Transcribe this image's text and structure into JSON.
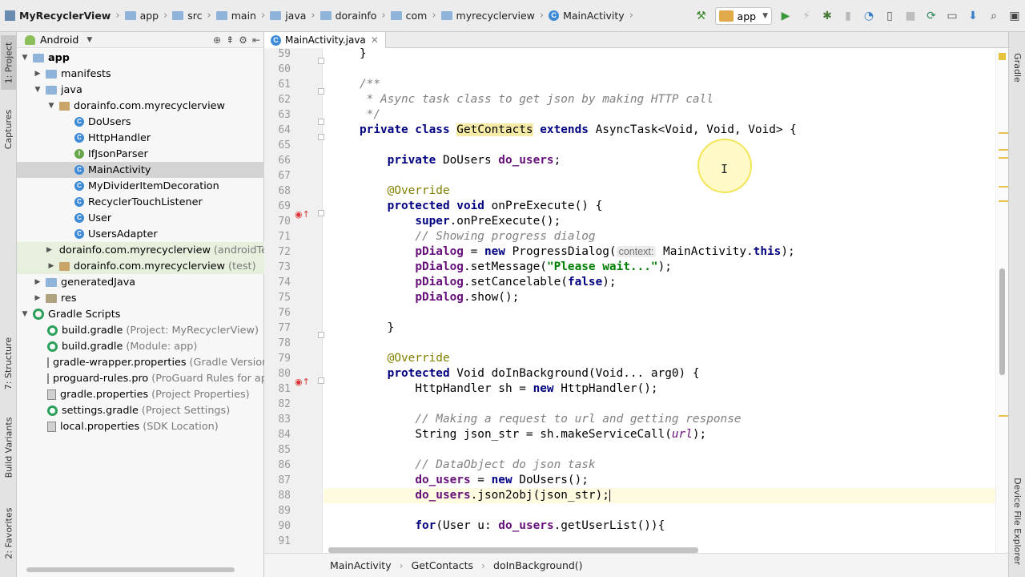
{
  "navbar": {
    "crumbs": [
      "MyRecyclerView",
      "app",
      "src",
      "main",
      "java",
      "dorainfo",
      "com",
      "myrecyclerview",
      "MainActivity"
    ],
    "run_config": "app"
  },
  "left_strip": {
    "tabs": [
      "1: Project",
      "Captures",
      "7: Structure",
      "Build Variants",
      "2: Favorites"
    ]
  },
  "right_strip": {
    "tabs": [
      "Gradle",
      "Device File Explorer"
    ]
  },
  "panel": {
    "view_mode": "Android"
  },
  "tree": [
    {
      "label": "app",
      "extra": ""
    },
    {
      "label": "manifests",
      "extra": ""
    },
    {
      "label": "java",
      "extra": ""
    },
    {
      "label": "dorainfo.com.myrecyclerview",
      "extra": ""
    },
    {
      "label": "DoUsers",
      "extra": ""
    },
    {
      "label": "HttpHandler",
      "extra": ""
    },
    {
      "label": "IfJsonParser",
      "extra": ""
    },
    {
      "label": "MainActivity",
      "extra": ""
    },
    {
      "label": "MyDividerItemDecoration",
      "extra": ""
    },
    {
      "label": "RecyclerTouchListener",
      "extra": ""
    },
    {
      "label": "User",
      "extra": ""
    },
    {
      "label": "UsersAdapter",
      "extra": ""
    },
    {
      "label": "dorainfo.com.myrecyclerview",
      "extra": "(androidTest)"
    },
    {
      "label": "dorainfo.com.myrecyclerview",
      "extra": "(test)"
    },
    {
      "label": "generatedJava",
      "extra": ""
    },
    {
      "label": "res",
      "extra": ""
    },
    {
      "label": "Gradle Scripts",
      "extra": ""
    },
    {
      "label": "build.gradle",
      "extra": "(Project: MyRecyclerView)"
    },
    {
      "label": "build.gradle",
      "extra": "(Module: app)"
    },
    {
      "label": "gradle-wrapper.properties",
      "extra": "(Gradle Version)"
    },
    {
      "label": "proguard-rules.pro",
      "extra": "(ProGuard Rules for app)"
    },
    {
      "label": "gradle.properties",
      "extra": "(Project Properties)"
    },
    {
      "label": "settings.gradle",
      "extra": "(Project Settings)"
    },
    {
      "label": "local.properties",
      "extra": "(SDK Location)"
    }
  ],
  "editor": {
    "tab_label": "MainActivity.java",
    "line_numbers": [
      "59",
      "60",
      "61",
      "62",
      "63",
      "64",
      "65",
      "66",
      "67",
      "68",
      "69",
      "70",
      "71",
      "72",
      "73",
      "74",
      "75",
      "76",
      "77",
      "78",
      "79",
      "80",
      "81",
      "82",
      "83",
      "84",
      "85",
      "86",
      "87",
      "88",
      "89",
      "90",
      "91"
    ],
    "code": {
      "l59": "}",
      "l61": "/**",
      "l62": " * Async task class to get json by making HTTP call",
      "l63": " */",
      "l64_kw1": "private class ",
      "l64_cls": "GetContacts",
      "l64_kw2": " extends ",
      "l64_rest": "AsyncTask<Void, Void, Void> {",
      "l66_kw": "private ",
      "l66_type": "DoUsers ",
      "l66_fld": "do_users",
      "l66_end": ";",
      "l68": "@Override",
      "l69_kw": "protected void ",
      "l69_rest": "onPreExecute() {",
      "l70_kw": "super",
      "l70_rest": ".onPreExecute();",
      "l71": "// Showing progress dialog",
      "l72_fld": "pDialog",
      "l72_mid": " = ",
      "l72_kw": "new ",
      "l72_call": "ProgressDialog(",
      "l72_hint": "context:",
      "l72_arg": " MainActivity.",
      "l72_this": "this",
      "l72_end": ");",
      "l73_fld": "pDialog",
      "l73_call": ".setMessage(",
      "l73_str": "\"Please wait...\"",
      "l73_end": ");",
      "l74_fld": "pDialog",
      "l74_call": ".setCancelable(",
      "l74_kw": "false",
      "l74_end": ");",
      "l75_fld": "pDialog",
      "l75_end": ".show();",
      "l77": "}",
      "l79": "@Override",
      "l80_kw": "protected ",
      "l80_rest": "Void doInBackground(Void... arg0) {",
      "l81_a": "HttpHandler sh = ",
      "l81_kw": "new ",
      "l81_b": "HttpHandler();",
      "l83": "// Making a request to url and getting response",
      "l84_a": "String json_str = sh.makeServiceCall(",
      "l84_it": "url",
      "l84_b": ");",
      "l86": "// DataObject do json task",
      "l87_fld": "do_users",
      "l87_mid": " = ",
      "l87_kw": "new ",
      "l87_end": "DoUsers();",
      "l88_fld": "do_users",
      "l88_end": ".json2obj(json_str);",
      "l90_kw": "for",
      "l90_a": "(User u: ",
      "l90_fld": "do_users",
      "l90_b": ".getUserList()){"
    }
  },
  "breadcrumb": [
    "MainActivity",
    "GetContacts",
    "doInBackground()"
  ]
}
